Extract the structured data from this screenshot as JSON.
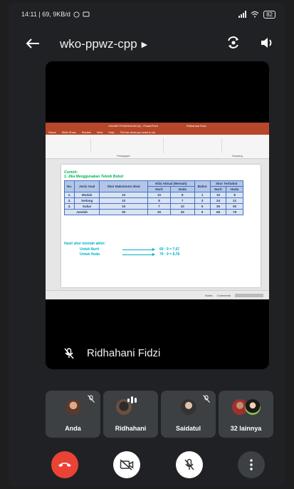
{
  "status_bar": {
    "time_info": "14:11 | 69, 9KB/d",
    "battery": "82"
  },
  "header": {
    "meeting_code": "wko-ppwz-cpp"
  },
  "presentation": {
    "window_title": "DASAR PENDIDIKAN (II) - PowerPoint",
    "user": "Ridhahani Fidzi",
    "menu": [
      "Home",
      "Slide Show",
      "Review",
      "View",
      "Help",
      "Tell me what you want to do"
    ],
    "group_paragraph": "Paragraph",
    "group_drawing": "Drawing",
    "slide": {
      "heading": "Contoh:",
      "subheading": "1. Jika Menggunakan Teknik Bobot",
      "table": {
        "headers": [
          "No.",
          "Jenis Soal",
          "Skor Maksimum Ideal",
          "Nilai Aktual (Mentah)",
          "Bobot",
          "Skor Terbobot"
        ],
        "subheaders": [
          "Nurit",
          "Huda",
          "Nurit",
          "Huda"
        ],
        "rows": [
          [
            "1.",
            "Mudah",
            "10",
            "10",
            "8",
            "1",
            "10",
            "8"
          ],
          [
            "2.",
            "Sedang",
            "10",
            "8",
            "7",
            "3",
            "24",
            "21"
          ],
          [
            "3.",
            "Sukar",
            "10",
            "7",
            "10",
            "5",
            "35",
            "50"
          ]
        ],
        "total": [
          "Jumlah",
          "30",
          "25",
          "25",
          "9",
          "69",
          "79"
        ]
      },
      "result_title": "Hasil skor mentah akhir:",
      "result_1_label": "Untuk Nurit",
      "result_1_value": "69 : 9 = 7,67",
      "result_2_label": "Untuk Huda",
      "result_2_value": "79 : 9 = 8,78"
    },
    "statusbar_items": [
      "Notes",
      "Comments"
    ]
  },
  "speaker": {
    "name": "Ridhahani Fidzi"
  },
  "participants": [
    {
      "label": "Anda"
    },
    {
      "label": "Ridhahani"
    },
    {
      "label": "Saidatul"
    },
    {
      "label": "32 lainnya"
    }
  ],
  "colors": {
    "end_call": "#ea4335",
    "tile_bg": "#3c4043",
    "background": "#202124",
    "ppt_accent": "#b7472a"
  }
}
